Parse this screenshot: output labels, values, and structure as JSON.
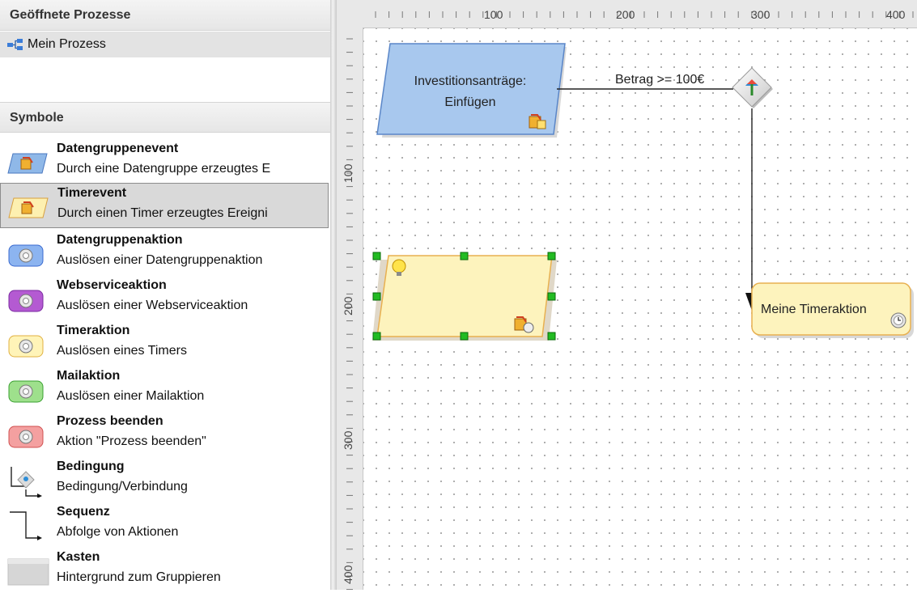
{
  "left_panel": {
    "open_processes_header": "Geöffnete Prozesse",
    "process_item": "Mein Prozess",
    "symbols_header": "Symbole",
    "symbols": [
      {
        "title": "Datengruppenevent",
        "desc": "Durch eine Datengruppe erzeugtes E",
        "icon": "datagroup-event-icon",
        "color": "#8fb8e8"
      },
      {
        "title": "Timerevent",
        "desc": "Durch einen Timer erzeugtes Ereigni",
        "icon": "timer-event-icon",
        "color": "#fdf0b0"
      },
      {
        "title": "Datengruppenaktion",
        "desc": "Auslösen einer Datengruppenaktion",
        "icon": "datagroup-action-icon",
        "color": "#8cb4f0"
      },
      {
        "title": "Webserviceaktion",
        "desc": "Auslösen einer Webserviceaktion",
        "icon": "webservice-action-icon",
        "color": "#b45ad2"
      },
      {
        "title": "Timeraktion",
        "desc": "Auslösen eines Timers",
        "icon": "timer-action-icon",
        "color": "#fff4b8"
      },
      {
        "title": "Mailaktion",
        "desc": "Auslösen einer Mailaktion",
        "icon": "mail-action-icon",
        "color": "#9ee08c"
      },
      {
        "title": "Prozess beenden",
        "desc": "Aktion \"Prozess beenden\"",
        "icon": "end-process-icon",
        "color": "#f4a0a0"
      },
      {
        "title": "Bedingung",
        "desc": "Bedingung/Verbindung",
        "icon": "condition-icon",
        "color": "#d0d0d0"
      },
      {
        "title": "Sequenz",
        "desc": "Abfolge von Aktionen",
        "icon": "sequence-icon",
        "color": "#000000"
      },
      {
        "title": "Kasten",
        "desc": "Hintergrund zum Gruppieren",
        "icon": "box-icon",
        "color": "#d6d6d6"
      }
    ],
    "selected_symbol": "Timerevent"
  },
  "ruler": {
    "top_labels": [
      "100",
      "200",
      "300",
      "400"
    ],
    "left_labels": [
      "100",
      "200",
      "300",
      "400"
    ]
  },
  "diagram": {
    "event_node_label": "Investitionsanträge: Einfügen",
    "event_line1": "Investitionsanträge:",
    "event_line2": "Einfügen",
    "condition_label": "Betrag >= 100€",
    "action_node_label": "Meine Timeraktion",
    "colors": {
      "event_fill": "#a8c8ee",
      "event_stroke": "#5a86c8",
      "timer_fill": "#fdf3bd",
      "timer_stroke": "#e8b050",
      "handle": "#22bb22"
    }
  }
}
